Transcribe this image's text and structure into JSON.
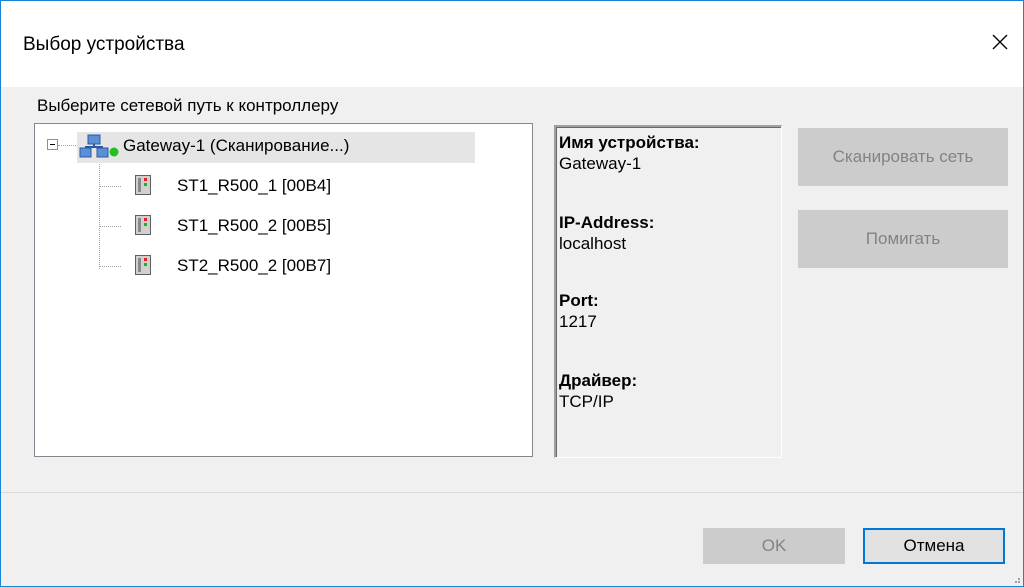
{
  "window": {
    "title": "Выбор устройства"
  },
  "path_label": "Выберите сетевой путь к контроллеру",
  "tree": {
    "root": {
      "label": "Gateway-1 (Сканирование...)",
      "status_color": "#22c022"
    },
    "children": [
      {
        "label": "ST1_R500_1 [00B4]"
      },
      {
        "label": "ST1_R500_2 [00B5]"
      },
      {
        "label": "ST2_R500_2 [00B7]"
      }
    ]
  },
  "info": {
    "device_name": {
      "key": "Имя устройства:",
      "value": "Gateway-1"
    },
    "ip_address": {
      "key": "IP-Address:",
      "value": "localhost"
    },
    "port": {
      "key": "Port:",
      "value": "1217"
    },
    "driver": {
      "key": "Драйвер:",
      "value": "TCP/IP"
    }
  },
  "buttons": {
    "scan": {
      "label": "Сканировать сеть",
      "enabled": false
    },
    "blink": {
      "label": "Помигать",
      "enabled": false
    },
    "ok": {
      "label": "OK",
      "enabled": false
    },
    "cancel": {
      "label": "Отмена",
      "enabled": true
    }
  },
  "colors": {
    "accent": "#0078d7",
    "window_border": "#1883d7",
    "panel_bg": "#f0f0f0"
  }
}
